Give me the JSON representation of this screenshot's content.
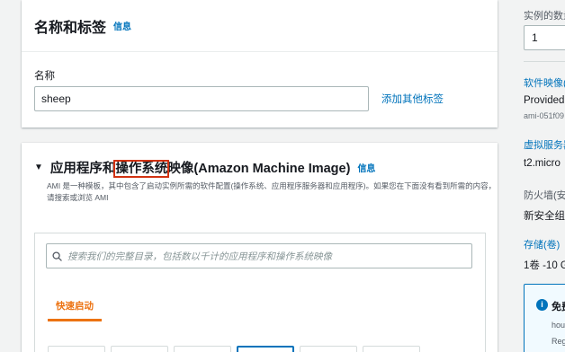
{
  "name_section": {
    "title": "名称和标签",
    "info": "信息",
    "name_label": "名称",
    "name_value": "sheep",
    "add_tags_link": "添加其他标签"
  },
  "ami_section": {
    "title_before": "应用程序和",
    "title_highlight": "操作系统",
    "title_after": "映像(Amazon Machine Image)",
    "info": "信息",
    "description": "AMI 是一种模板，其中包含了启动实例所需的软件配置(操作系统、应用程序服务器和应用程序)。如果您在下面没有看到所需的内容，请搜索或浏览 AMI",
    "search_placeholder": "搜索我们的完整目录，包括数以千计的应用程序和操作系统映像",
    "quickstart_tab": "快速启动"
  },
  "summary": {
    "instance_count_label": "实例的数量",
    "instance_count_value": "1",
    "software_image_label": "软件映像(A",
    "software_image_value": "Provided b",
    "software_image_ami": "ami-051f09",
    "server_type_label": "虚拟服务器",
    "server_type_value": "t2.micro",
    "firewall_label": "防火墙(安全",
    "firewall_value": "新安全组",
    "storage_label": "存储(卷)",
    "storage_value": "1卷 -10 Gi",
    "free_tier_title": "免费",
    "free_tier_line1": "hou",
    "free_tier_line2": "Reg"
  },
  "colors": {
    "link": "#0073bb",
    "accent_orange": "#ec7211",
    "highlight_red": "#d13212"
  }
}
